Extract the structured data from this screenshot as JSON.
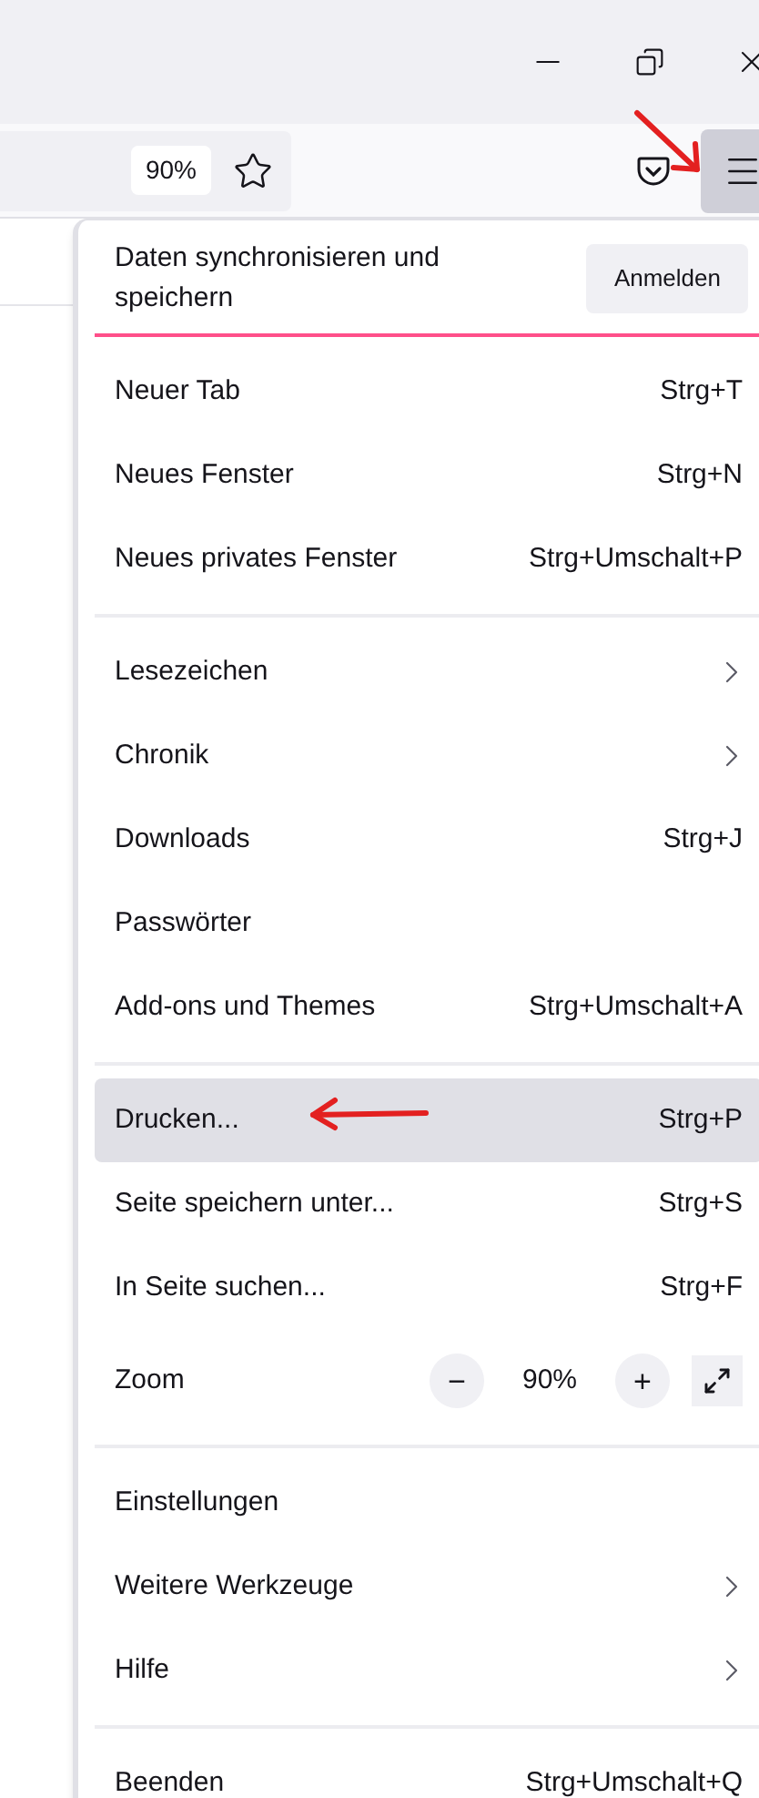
{
  "toolbar": {
    "zoom_badge": "90%"
  },
  "menu": {
    "sync": {
      "text": "Daten synchronisieren und speichern",
      "button": "Anmelden"
    },
    "sections": [
      [
        {
          "kind": "shortcut",
          "label": "Neuer Tab",
          "shortcut": "Strg+T",
          "selected": false
        },
        {
          "kind": "shortcut",
          "label": "Neues Fenster",
          "shortcut": "Strg+N",
          "selected": false
        },
        {
          "kind": "shortcut",
          "label": "Neues privates Fenster",
          "shortcut": "Strg+Umschalt+P",
          "selected": false
        }
      ],
      [
        {
          "kind": "submenu",
          "label": "Lesezeichen",
          "selected": false
        },
        {
          "kind": "submenu",
          "label": "Chronik",
          "selected": false
        },
        {
          "kind": "shortcut",
          "label": "Downloads",
          "shortcut": "Strg+J",
          "selected": false
        },
        {
          "kind": "plain",
          "label": "Passwörter",
          "selected": false
        },
        {
          "kind": "shortcut",
          "label": "Add-ons und Themes",
          "shortcut": "Strg+Umschalt+A",
          "selected": false
        }
      ],
      [
        {
          "kind": "shortcut",
          "label": "Drucken...",
          "shortcut": "Strg+P",
          "selected": true
        },
        {
          "kind": "shortcut",
          "label": "Seite speichern unter...",
          "shortcut": "Strg+S",
          "selected": false
        },
        {
          "kind": "shortcut",
          "label": "In Seite suchen...",
          "shortcut": "Strg+F",
          "selected": false
        },
        {
          "kind": "zoom",
          "label": "Zoom",
          "minus": "−",
          "value": "90%",
          "plus": "+",
          "selected": false
        }
      ],
      [
        {
          "kind": "plain",
          "label": "Einstellungen",
          "selected": false
        },
        {
          "kind": "submenu",
          "label": "Weitere Werkzeuge",
          "selected": false
        },
        {
          "kind": "submenu",
          "label": "Hilfe",
          "selected": false
        }
      ],
      [
        {
          "kind": "shortcut",
          "label": "Beenden",
          "shortcut": "Strg+Umschalt+Q",
          "selected": false
        }
      ]
    ]
  }
}
